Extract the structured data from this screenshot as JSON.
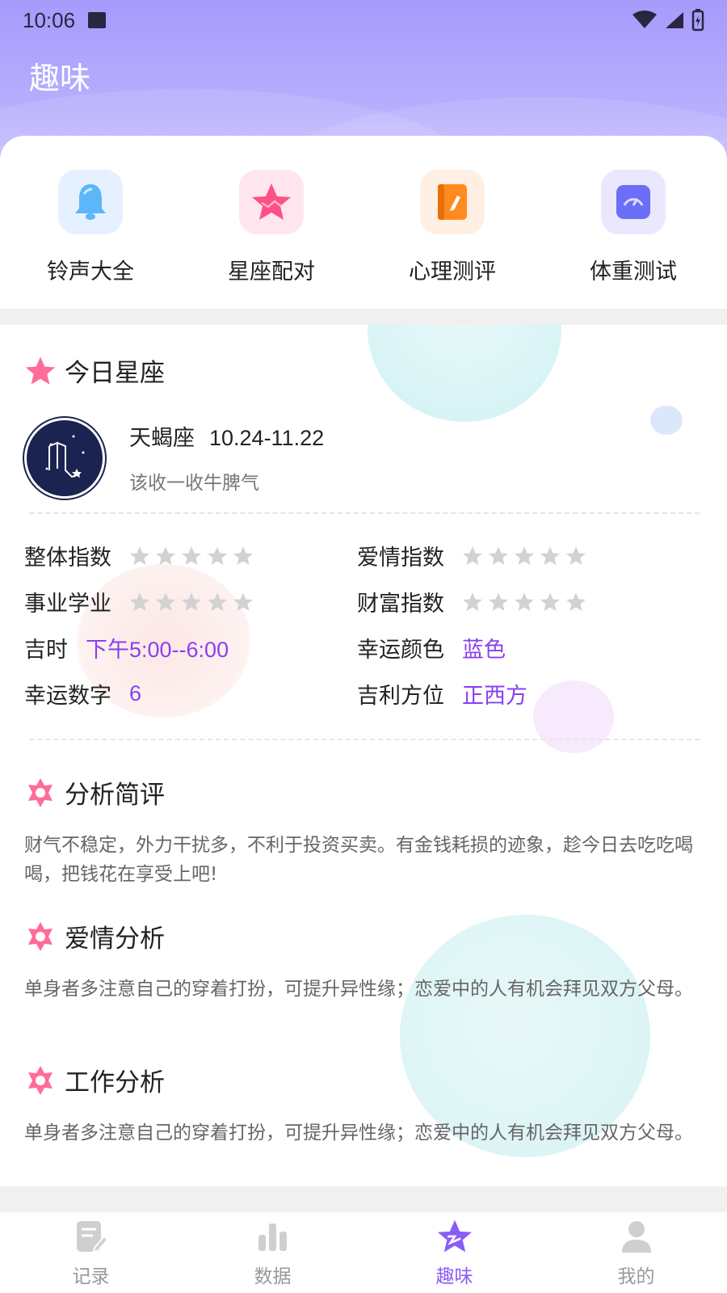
{
  "status_bar": {
    "time": "10:06"
  },
  "page": {
    "title": "趣味"
  },
  "shortcuts": [
    {
      "label": "铃声大全",
      "icon": "bell-icon",
      "bg": "#e6f1ff"
    },
    {
      "label": "星座配对",
      "icon": "star-icon",
      "bg": "#ffe6ee"
    },
    {
      "label": "心理测评",
      "icon": "notebook-icon",
      "bg": "#fff0e3"
    },
    {
      "label": "体重测试",
      "icon": "scale-icon",
      "bg": "#e9e8ff"
    }
  ],
  "today": {
    "section_title": "今日星座",
    "sign_name": "天蝎座",
    "date_range": "10.24-11.22",
    "motto": "该收一收牛脾气"
  },
  "indices": {
    "overall": {
      "label": "整体指数",
      "stars_filled": 0,
      "stars_total": 5
    },
    "love": {
      "label": "爱情指数",
      "stars_filled": 0,
      "stars_total": 5
    },
    "career": {
      "label": "事业学业",
      "stars_filled": 0,
      "stars_total": 5
    },
    "wealth": {
      "label": "财富指数",
      "stars_filled": 0,
      "stars_total": 5
    },
    "lucky_time": {
      "label": "吉时",
      "value": "下午5:00--6:00"
    },
    "lucky_color": {
      "label": "幸运颜色",
      "value": "蓝色"
    },
    "lucky_number": {
      "label": "幸运数字",
      "value": "6"
    },
    "lucky_direction": {
      "label": "吉利方位",
      "value": "正西方"
    }
  },
  "analysis": {
    "summary": {
      "title": "分析简评",
      "text": "财气不稳定，外力干扰多，不利于投资买卖。有金钱耗损的迹象，趁今日去吃吃喝喝，把钱花在享受上吧!"
    },
    "love": {
      "title": "爱情分析",
      "text": "单身者多注意自己的穿着打扮，可提升异性缘；恋爱中的人有机会拜见双方父母。"
    },
    "work": {
      "title": "工作分析",
      "text": "单身者多注意自己的穿着打扮，可提升异性缘；恋爱中的人有机会拜见双方父母。"
    }
  },
  "bottom_nav": [
    {
      "label": "记录",
      "icon": "record-icon",
      "active": false
    },
    {
      "label": "数据",
      "icon": "chart-icon",
      "active": false
    },
    {
      "label": "趣味",
      "icon": "star-icon",
      "active": true
    },
    {
      "label": "我的",
      "icon": "profile-icon",
      "active": false
    }
  ],
  "colors": {
    "accent": "#8a3ff0",
    "header": "#a69bfc",
    "nav_active": "#8a5cf6"
  }
}
